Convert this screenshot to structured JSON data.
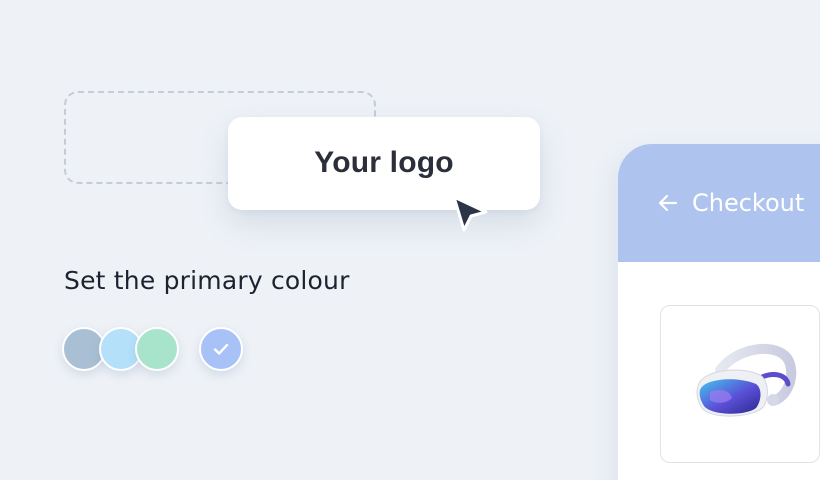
{
  "logo": {
    "text": "Your logo"
  },
  "colour_picker": {
    "label": "Set the primary colour",
    "swatches": [
      {
        "color": "#a9c0d4",
        "selected": false
      },
      {
        "color": "#b4e1f9",
        "selected": false
      },
      {
        "color": "#a8e3cc",
        "selected": false
      },
      {
        "color": "#a8c2f8",
        "selected": true
      }
    ]
  },
  "checkout": {
    "title": "Checkout",
    "header_color": "#aec3ee",
    "product_icon": "vr-headset-icon"
  },
  "cursor_icon": "pointer-cursor-icon"
}
